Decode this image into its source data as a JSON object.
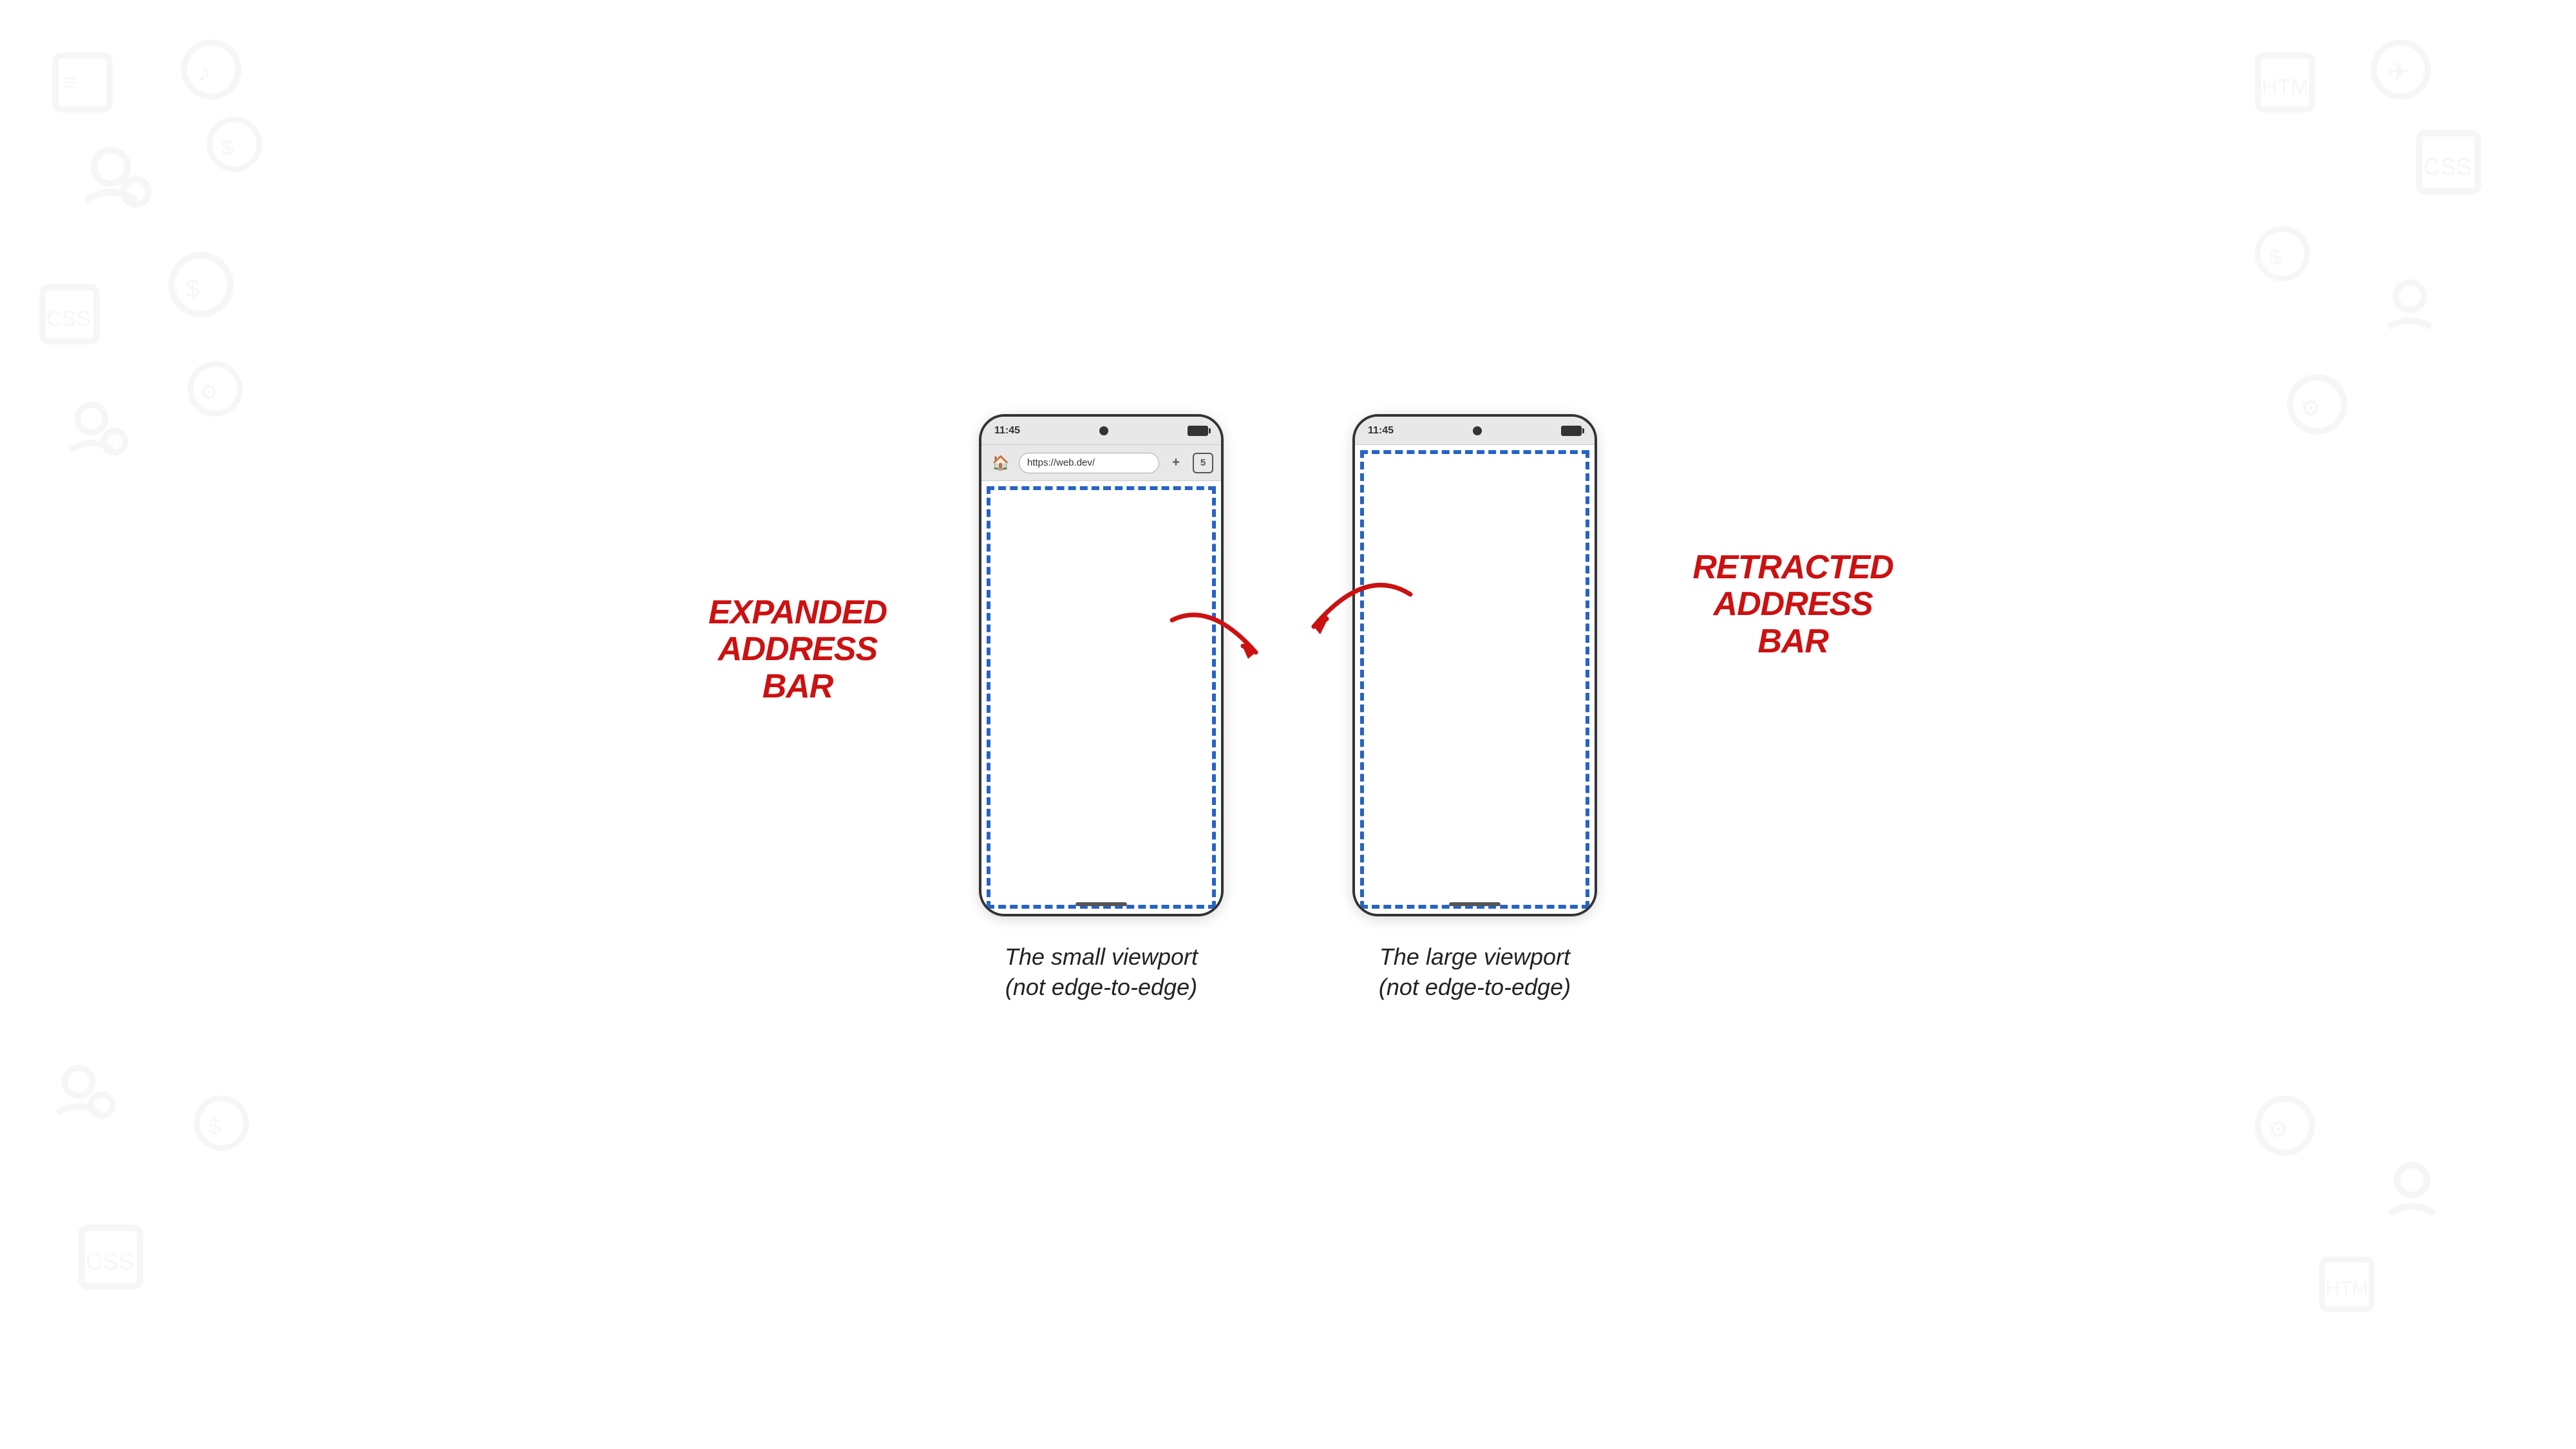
{
  "page": {
    "background": "#ffffff"
  },
  "phone_expanded": {
    "status_bar": {
      "time": "11:45",
      "battery_visible": true
    },
    "address_bar": {
      "url": "https://web.dev/",
      "new_tab_icon": "+",
      "tabs_count": "5"
    },
    "caption_line1": "The small viewport",
    "caption_line2": "(not edge-to-edge)"
  },
  "phone_retracted": {
    "status_bar": {
      "time": "11:45",
      "battery_visible": true
    },
    "caption_line1": "The large viewport",
    "caption_line2": "(not edge-to-edge)"
  },
  "annotation_expanded": {
    "line1": "Expanded",
    "line2": "Address",
    "line3": "Bar"
  },
  "annotation_retracted": {
    "line1": "Retracted",
    "line2": "Address",
    "line3": "Bar"
  }
}
